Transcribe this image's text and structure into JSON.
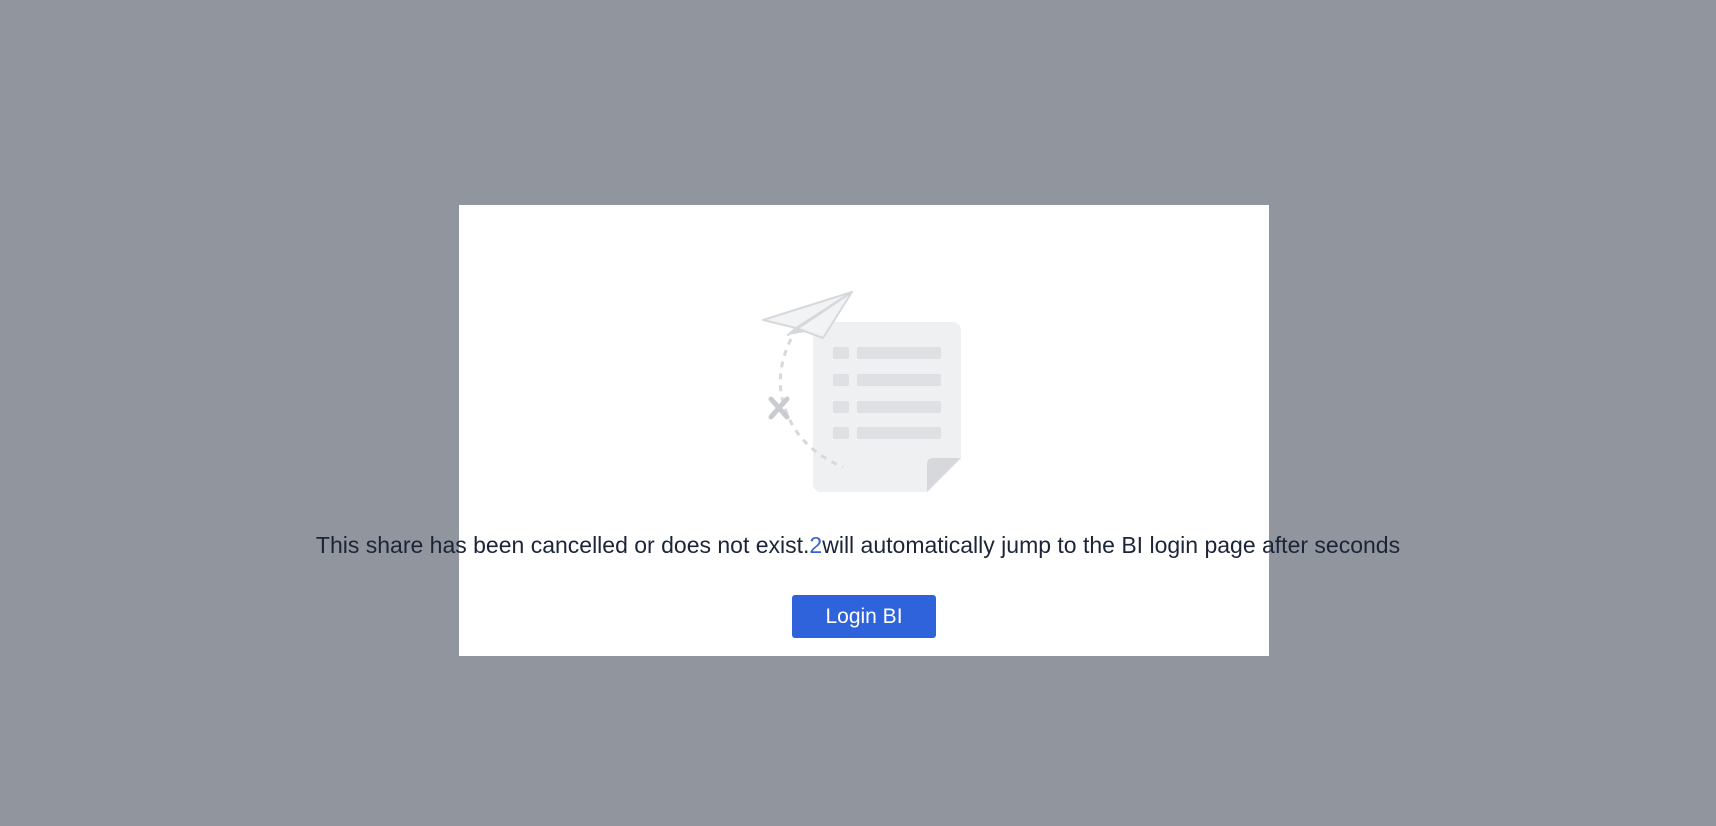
{
  "dialog": {
    "message_before": "This share has been cancelled or does not exist.",
    "countdown": "2",
    "message_after": "will automatically jump to the BI login page after seconds",
    "login_button_label": "Login BI"
  },
  "illustration": {
    "icon": "paper-plane-document-empty-icon"
  },
  "colors": {
    "overlay": "#91959e",
    "modal_bg": "#ffffff",
    "text": "#1b2538",
    "countdown": "#3863d8",
    "button_bg": "#2e63db",
    "button_text": "#ffffff",
    "illustration_light": "#eff0f2",
    "illustration_mid": "#d6d8dc"
  }
}
